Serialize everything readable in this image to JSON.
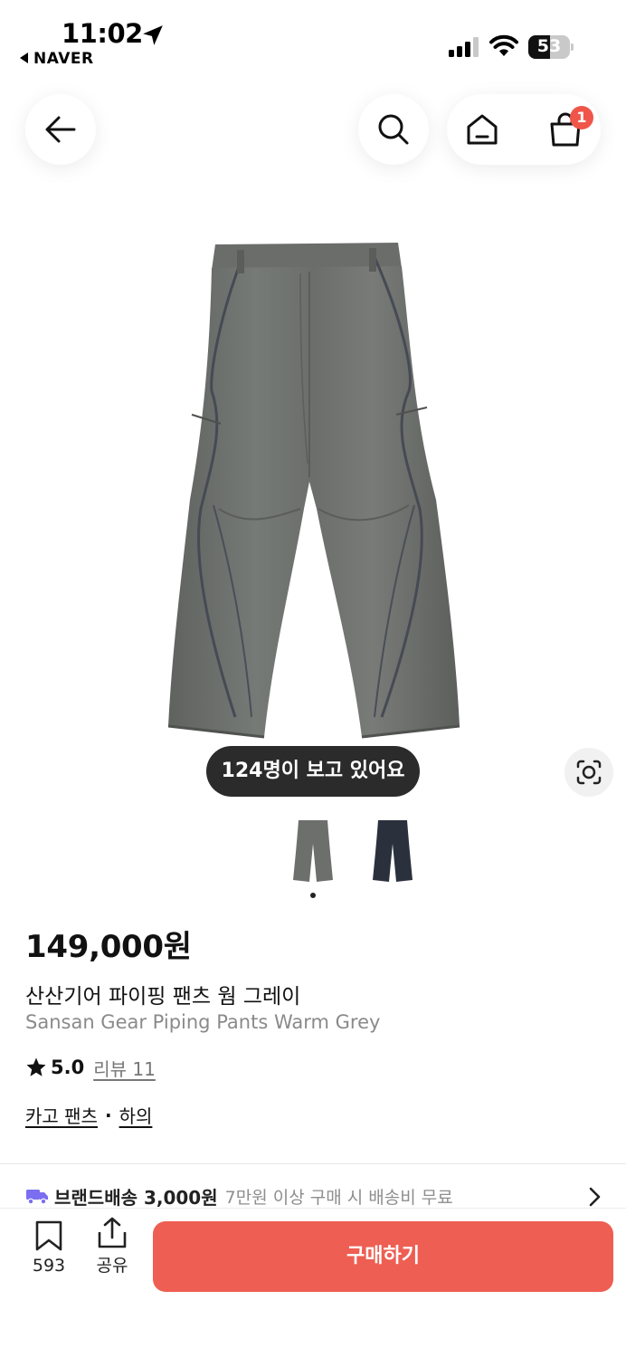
{
  "status_bar": {
    "time": "11:02",
    "back_app": "NAVER",
    "battery": "53",
    "battery_level": 0.53
  },
  "nav": {
    "back_icon": "arrow-left-icon",
    "search_icon": "search-icon",
    "home_icon": "home-icon",
    "cart_icon": "shopping-bag-icon",
    "cart_count": "1"
  },
  "product": {
    "viewers": "124명이 보고 있어요",
    "price": "149,000원",
    "name_ko": "산산기어 파이핑 팬츠 웜 그레이",
    "name_en": "Sansan Gear Piping Pants Warm Grey",
    "rating": "5.0",
    "review_label": "리뷰 11",
    "categories": [
      "카고 팬츠",
      "하의"
    ],
    "category_separator": "·",
    "colors": {
      "grey": "#6d6f6c",
      "navy": "#2a313d"
    }
  },
  "shipping": {
    "label": "브랜드배송 3,000원",
    "note": "7만원 이상 구매 시 배송비 무료"
  },
  "bottom_bar": {
    "save_count": "593",
    "share_label": "공유",
    "buy_label": "구매하기"
  },
  "theme": {
    "accent": "#ee5e52",
    "badge": "#f0554a"
  }
}
